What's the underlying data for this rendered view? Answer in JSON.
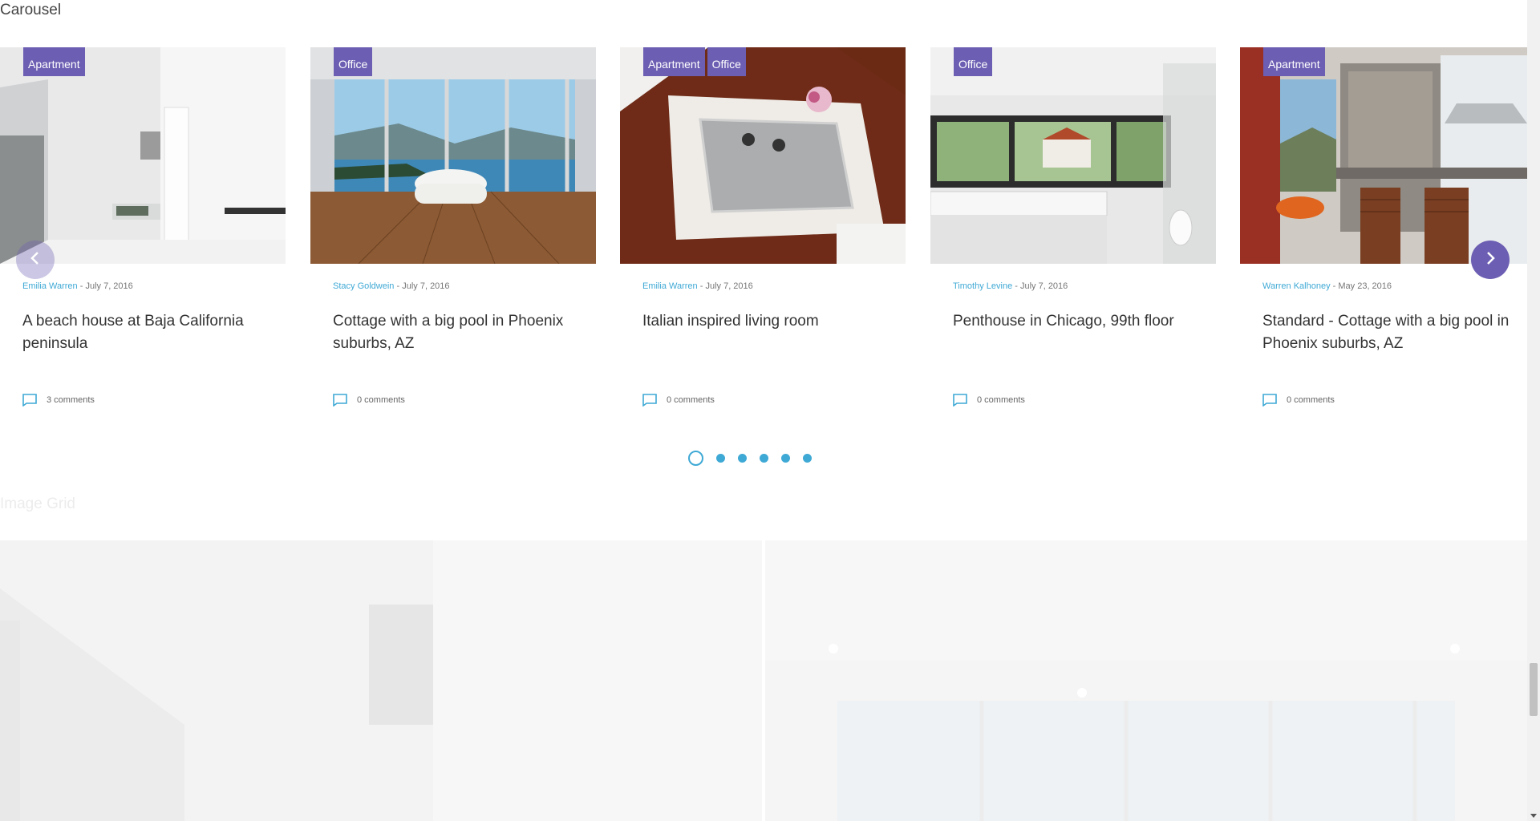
{
  "sections": {
    "carousel_title": "Carousel",
    "grid_title": "Image Grid"
  },
  "carousel": {
    "prev_icon": "chevron-left-icon",
    "next_icon": "chevron-right-icon",
    "page_count": 6,
    "active_page": 1,
    "cards": [
      {
        "badges": [
          "Apartment"
        ],
        "author": "Emilia Warren",
        "date": "July 7, 2016",
        "title": "A beach house at Baja California peninsula",
        "comments": "3 comments"
      },
      {
        "badges": [
          "Office"
        ],
        "author": "Stacy Goldwein",
        "date": "July 7, 2016",
        "title": "Cottage with a big pool in Phoenix suburbs, AZ",
        "comments": "0 comments"
      },
      {
        "badges": [
          "Apartment",
          "Office"
        ],
        "author": "Emilia Warren",
        "date": "July 7, 2016",
        "title": "Italian inspired living room",
        "comments": "0 comments"
      },
      {
        "badges": [
          "Office"
        ],
        "author": "Timothy Levine",
        "date": "July 7, 2016",
        "title": "Penthouse in Chicago, 99th floor",
        "comments": "0 comments"
      },
      {
        "badges": [
          "Apartment"
        ],
        "author": "Warren Kalhoney",
        "date": "May 23, 2016",
        "title": "Standard - Cottage with a big pool in Phoenix suburbs, AZ",
        "comments": "0 comments"
      }
    ]
  },
  "colors": {
    "accent": "#6c5fb3",
    "link": "#3fa9d5"
  }
}
